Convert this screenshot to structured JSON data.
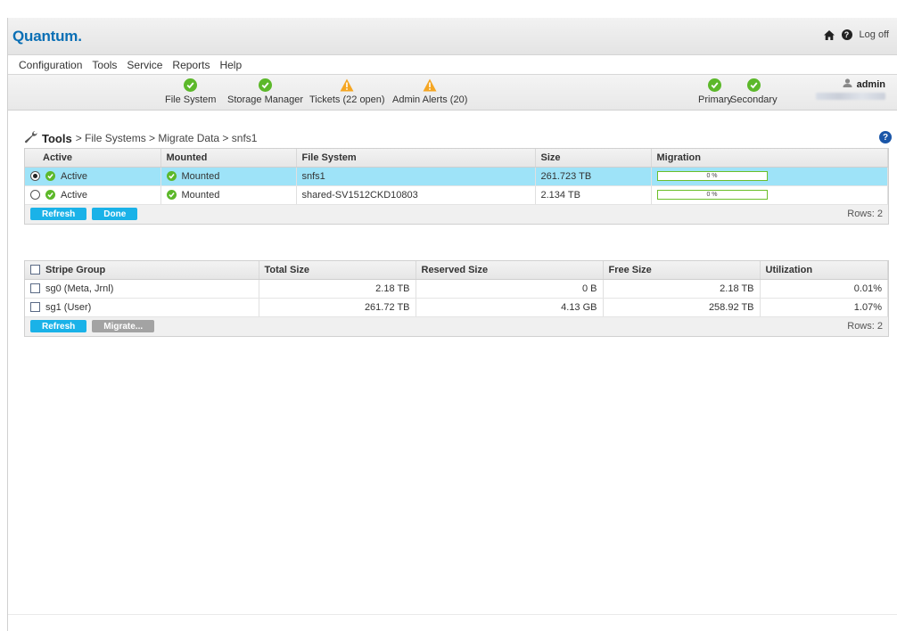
{
  "header": {
    "logo": "Quantum",
    "logo_dot": ".",
    "logoff": "Log off"
  },
  "menu": [
    "Configuration",
    "Tools",
    "Service",
    "Reports",
    "Help"
  ],
  "status": {
    "file_system": "File System",
    "storage_manager": "Storage Manager",
    "tickets": "Tickets (22 open)",
    "admin_alerts": "Admin Alerts (20)",
    "primary": "Primary",
    "secondary": "Secondary",
    "user": "admin"
  },
  "breadcrumb": {
    "tools": "Tools",
    "path": "> File Systems > Migrate Data > snfs1"
  },
  "fs_table": {
    "headers": [
      "Active",
      "Mounted",
      "File System",
      "Size",
      "Migration"
    ],
    "rows": [
      {
        "active": "Active",
        "mounted": "Mounted",
        "file_system": "snfs1",
        "size": "261.723 TB",
        "migration": "0 %",
        "migration_fraction": 0,
        "selected": true
      },
      {
        "active": "Active",
        "mounted": "Mounted",
        "file_system": "shared-SV1512CKD10803",
        "size": "2.134 TB",
        "migration": "0 %",
        "migration_fraction": 0,
        "selected": false
      }
    ],
    "refresh": "Refresh",
    "done": "Done",
    "rows_label": "Rows: 2"
  },
  "sg_table": {
    "headers": [
      "Stripe Group",
      "Total Size",
      "Reserved Size",
      "Free Size",
      "Utilization"
    ],
    "rows": [
      {
        "name": "sg0 (Meta, Jrnl)",
        "total": "2.18 TB",
        "reserved": "0 B",
        "free": "2.18 TB",
        "util": "0.01%"
      },
      {
        "name": "sg1 (User)",
        "total": "261.72 TB",
        "reserved": "4.13 GB",
        "free": "258.92 TB",
        "util": "1.07%"
      }
    ],
    "refresh": "Refresh",
    "migrate": "Migrate...",
    "rows_label": "Rows: 2"
  },
  "colors": {
    "accent": "#1ab2e8",
    "brand": "#0a6fb5",
    "ok": "#5cb82a",
    "warn": "#f5a623",
    "selected_row": "#9ee3f8"
  }
}
